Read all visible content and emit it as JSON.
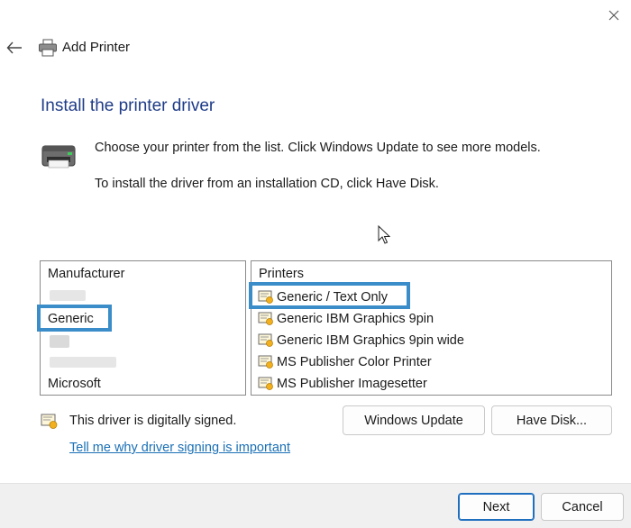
{
  "window": {
    "title": "Add Printer",
    "icons": {
      "close": "close-icon",
      "back": "back-arrow-icon",
      "wizard": "printer-icon"
    }
  },
  "main": {
    "heading": "Install the printer driver",
    "description_line1": "Choose your printer from the list. Click Windows Update to see more models.",
    "description_line2": "To install the driver from an installation CD, click Have Disk."
  },
  "manufacturer_list": {
    "header": "Manufacturer",
    "selected": "Generic",
    "items": [
      "Generic",
      "Microsoft"
    ]
  },
  "printer_list": {
    "header": "Printers",
    "selected": "Generic / Text Only",
    "items": [
      "Generic / Text Only",
      "Generic IBM Graphics 9pin",
      "Generic IBM Graphics 9pin wide",
      "MS Publisher Color Printer",
      "MS Publisher Imagesetter"
    ]
  },
  "signing": {
    "status_text": "This driver is digitally signed.",
    "link_text": "Tell me why driver signing is important",
    "icon": "certificate-icon"
  },
  "buttons": {
    "windows_update": "Windows Update",
    "have_disk": "Have Disk...",
    "next": "Next",
    "cancel": "Cancel"
  },
  "colors": {
    "heading": "#1f3c88",
    "selection_highlight": "#3a8dc8",
    "link": "#1a6fb5",
    "footer_bg": "#f0f0f0"
  }
}
